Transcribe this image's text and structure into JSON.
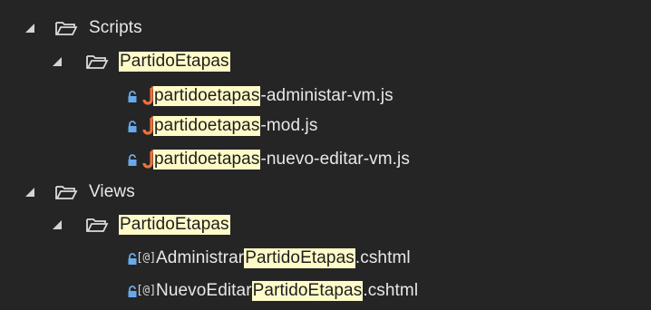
{
  "solution_tree": {
    "scripts_folder": {
      "label": "Scripts",
      "expanded": true
    },
    "scripts_sub": {
      "label": "PartidoEtapas",
      "expanded": true
    },
    "js_files": [
      {
        "match": "partidoetapas",
        "rest": "-administar-vm.js"
      },
      {
        "match": "partidoetapas",
        "rest": "-mod.js"
      },
      {
        "match": "partidoetapas",
        "rest": "-nuevo-editar-vm.js"
      }
    ],
    "views_folder": {
      "label": "Views",
      "expanded": true
    },
    "views_sub": {
      "label": "PartidoEtapas",
      "expanded": true
    },
    "cshtml_files": [
      {
        "prefix": "Administrar",
        "match": "PartidoEtapas",
        "suffix": ".cshtml"
      },
      {
        "prefix": "NuevoEditar",
        "match": "PartidoEtapas",
        "suffix": ".cshtml"
      }
    ],
    "razor_glyph": "[@]"
  },
  "colors": {
    "background": "#252526",
    "text": "#e8e8e8",
    "highlight": "#fffbc8",
    "folder": "#dcdcaa",
    "js_icon": "#f0703a",
    "lock": "#6aa9e9"
  }
}
